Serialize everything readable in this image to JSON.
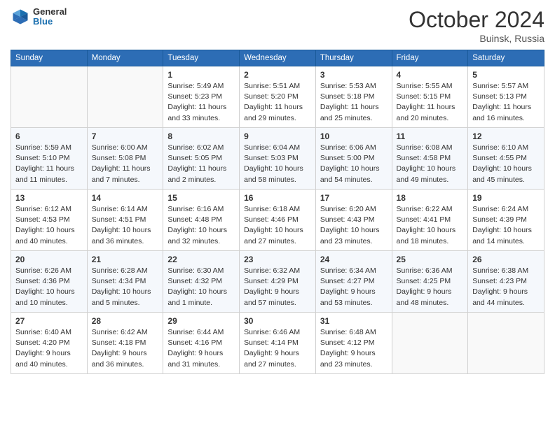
{
  "header": {
    "logo_general": "General",
    "logo_blue": "Blue",
    "month_title": "October 2024",
    "location": "Buinsk, Russia"
  },
  "weekdays": [
    "Sunday",
    "Monday",
    "Tuesday",
    "Wednesday",
    "Thursday",
    "Friday",
    "Saturday"
  ],
  "weeks": [
    [
      {
        "day": "",
        "info": ""
      },
      {
        "day": "",
        "info": ""
      },
      {
        "day": "1",
        "info": "Sunrise: 5:49 AM\nSunset: 5:23 PM\nDaylight: 11 hours\nand 33 minutes."
      },
      {
        "day": "2",
        "info": "Sunrise: 5:51 AM\nSunset: 5:20 PM\nDaylight: 11 hours\nand 29 minutes."
      },
      {
        "day": "3",
        "info": "Sunrise: 5:53 AM\nSunset: 5:18 PM\nDaylight: 11 hours\nand 25 minutes."
      },
      {
        "day": "4",
        "info": "Sunrise: 5:55 AM\nSunset: 5:15 PM\nDaylight: 11 hours\nand 20 minutes."
      },
      {
        "day": "5",
        "info": "Sunrise: 5:57 AM\nSunset: 5:13 PM\nDaylight: 11 hours\nand 16 minutes."
      }
    ],
    [
      {
        "day": "6",
        "info": "Sunrise: 5:59 AM\nSunset: 5:10 PM\nDaylight: 11 hours\nand 11 minutes."
      },
      {
        "day": "7",
        "info": "Sunrise: 6:00 AM\nSunset: 5:08 PM\nDaylight: 11 hours\nand 7 minutes."
      },
      {
        "day": "8",
        "info": "Sunrise: 6:02 AM\nSunset: 5:05 PM\nDaylight: 11 hours\nand 2 minutes."
      },
      {
        "day": "9",
        "info": "Sunrise: 6:04 AM\nSunset: 5:03 PM\nDaylight: 10 hours\nand 58 minutes."
      },
      {
        "day": "10",
        "info": "Sunrise: 6:06 AM\nSunset: 5:00 PM\nDaylight: 10 hours\nand 54 minutes."
      },
      {
        "day": "11",
        "info": "Sunrise: 6:08 AM\nSunset: 4:58 PM\nDaylight: 10 hours\nand 49 minutes."
      },
      {
        "day": "12",
        "info": "Sunrise: 6:10 AM\nSunset: 4:55 PM\nDaylight: 10 hours\nand 45 minutes."
      }
    ],
    [
      {
        "day": "13",
        "info": "Sunrise: 6:12 AM\nSunset: 4:53 PM\nDaylight: 10 hours\nand 40 minutes."
      },
      {
        "day": "14",
        "info": "Sunrise: 6:14 AM\nSunset: 4:51 PM\nDaylight: 10 hours\nand 36 minutes."
      },
      {
        "day": "15",
        "info": "Sunrise: 6:16 AM\nSunset: 4:48 PM\nDaylight: 10 hours\nand 32 minutes."
      },
      {
        "day": "16",
        "info": "Sunrise: 6:18 AM\nSunset: 4:46 PM\nDaylight: 10 hours\nand 27 minutes."
      },
      {
        "day": "17",
        "info": "Sunrise: 6:20 AM\nSunset: 4:43 PM\nDaylight: 10 hours\nand 23 minutes."
      },
      {
        "day": "18",
        "info": "Sunrise: 6:22 AM\nSunset: 4:41 PM\nDaylight: 10 hours\nand 18 minutes."
      },
      {
        "day": "19",
        "info": "Sunrise: 6:24 AM\nSunset: 4:39 PM\nDaylight: 10 hours\nand 14 minutes."
      }
    ],
    [
      {
        "day": "20",
        "info": "Sunrise: 6:26 AM\nSunset: 4:36 PM\nDaylight: 10 hours\nand 10 minutes."
      },
      {
        "day": "21",
        "info": "Sunrise: 6:28 AM\nSunset: 4:34 PM\nDaylight: 10 hours\nand 5 minutes."
      },
      {
        "day": "22",
        "info": "Sunrise: 6:30 AM\nSunset: 4:32 PM\nDaylight: 10 hours\nand 1 minute."
      },
      {
        "day": "23",
        "info": "Sunrise: 6:32 AM\nSunset: 4:29 PM\nDaylight: 9 hours\nand 57 minutes."
      },
      {
        "day": "24",
        "info": "Sunrise: 6:34 AM\nSunset: 4:27 PM\nDaylight: 9 hours\nand 53 minutes."
      },
      {
        "day": "25",
        "info": "Sunrise: 6:36 AM\nSunset: 4:25 PM\nDaylight: 9 hours\nand 48 minutes."
      },
      {
        "day": "26",
        "info": "Sunrise: 6:38 AM\nSunset: 4:23 PM\nDaylight: 9 hours\nand 44 minutes."
      }
    ],
    [
      {
        "day": "27",
        "info": "Sunrise: 6:40 AM\nSunset: 4:20 PM\nDaylight: 9 hours\nand 40 minutes."
      },
      {
        "day": "28",
        "info": "Sunrise: 6:42 AM\nSunset: 4:18 PM\nDaylight: 9 hours\nand 36 minutes."
      },
      {
        "day": "29",
        "info": "Sunrise: 6:44 AM\nSunset: 4:16 PM\nDaylight: 9 hours\nand 31 minutes."
      },
      {
        "day": "30",
        "info": "Sunrise: 6:46 AM\nSunset: 4:14 PM\nDaylight: 9 hours\nand 27 minutes."
      },
      {
        "day": "31",
        "info": "Sunrise: 6:48 AM\nSunset: 4:12 PM\nDaylight: 9 hours\nand 23 minutes."
      },
      {
        "day": "",
        "info": ""
      },
      {
        "day": "",
        "info": ""
      }
    ]
  ]
}
